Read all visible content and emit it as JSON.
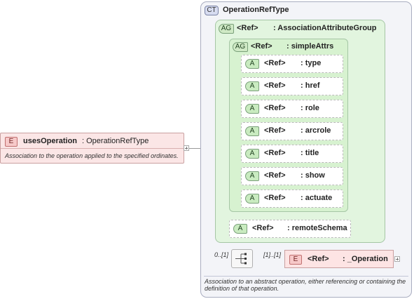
{
  "root_element": {
    "badge": "E",
    "name": "usesOperation",
    "type": ": OperationRefType",
    "doc": "Association to the operation applied to the specified ordinates."
  },
  "complex_type": {
    "badge": "CT",
    "name": "OperationRefType",
    "doc": "Association to an abstract operation, either referencing or containing the definition of that operation."
  },
  "attr_group_outer": {
    "badge": "AG",
    "ref": "<Ref>",
    "name": ": AssociationAttributeGroup"
  },
  "attr_group_inner": {
    "badge": "AG",
    "ref": "<Ref>",
    "name": ": simpleAttrs"
  },
  "attributes": [
    {
      "badge": "A",
      "ref": "<Ref>",
      "name": ": type"
    },
    {
      "badge": "A",
      "ref": "<Ref>",
      "name": ": href"
    },
    {
      "badge": "A",
      "ref": "<Ref>",
      "name": ": role"
    },
    {
      "badge": "A",
      "ref": "<Ref>",
      "name": ": arcrole"
    },
    {
      "badge": "A",
      "ref": "<Ref>",
      "name": ": title"
    },
    {
      "badge": "A",
      "ref": "<Ref>",
      "name": ": show"
    },
    {
      "badge": "A",
      "ref": "<Ref>",
      "name": ": actuate"
    }
  ],
  "remote_schema": {
    "badge": "A",
    "ref": "<Ref>",
    "name": ": remoteSchema"
  },
  "sequence": {
    "occurrence": "0..[1]"
  },
  "operation": {
    "badge": "E",
    "ref": "<Ref>",
    "name": ": _Operation",
    "occurrence": "[1]..[1]"
  }
}
